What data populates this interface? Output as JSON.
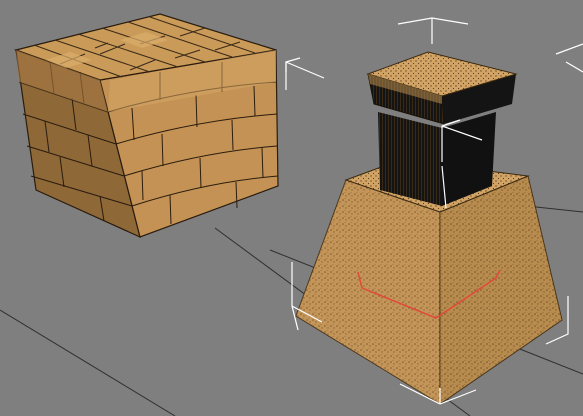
{
  "viewport": {
    "background_color": "#7f7f7f",
    "grid_color": "#2f2f2f",
    "selection_bracket_color": "#ffffff",
    "pivot_axis_color": "#e04a3a"
  },
  "objects": [
    {
      "name": "brick-box",
      "material": "brick",
      "colors": {
        "face": "#b88a4e",
        "light": "#d6a864",
        "dark": "#8b6434",
        "mortar": "#3a2a18"
      },
      "selected": false
    },
    {
      "name": "pedestal",
      "material": "wood",
      "colors": {
        "face": "#c49558",
        "light": "#d8ae70",
        "dark": "#a47a40",
        "column": "#141414"
      },
      "selected": true
    }
  ]
}
